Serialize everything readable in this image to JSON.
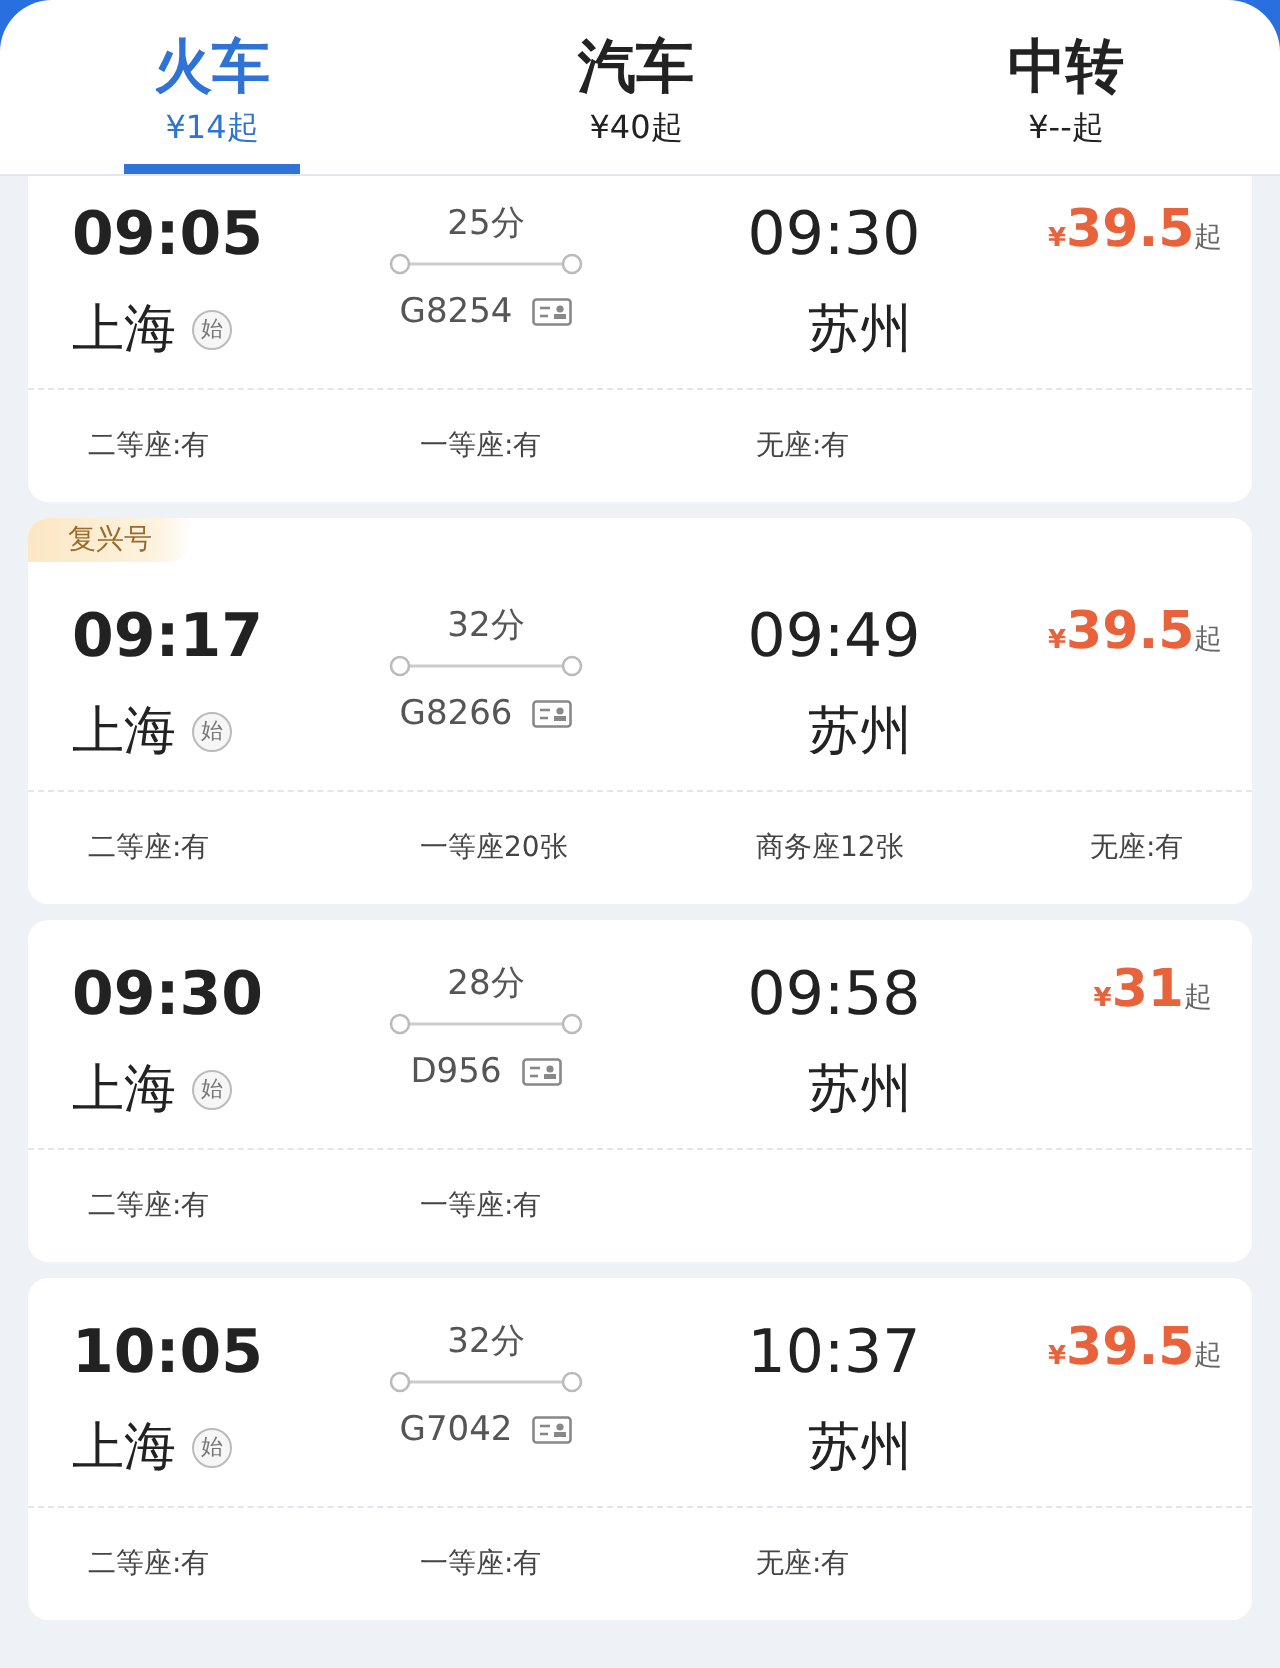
{
  "tabs": [
    {
      "label": "火车",
      "price": "¥14起",
      "selected": true
    },
    {
      "label": "汽车",
      "price": "¥40起",
      "selected": false
    },
    {
      "label": "中转",
      "price": "¥--起",
      "selected": false
    }
  ],
  "trains": [
    {
      "depart_time": "09:05",
      "depart_station": "上海",
      "origin_mark": "始",
      "duration": "25分",
      "train_no": "G8254",
      "arrive_time": "09:30",
      "arrive_station": "苏州",
      "currency": "¥",
      "price": "39.5",
      "price_suffix": "起",
      "seats": [
        "二等座:有",
        "一等座:有",
        "无座:有"
      ]
    },
    {
      "badge": "复兴号",
      "depart_time": "09:17",
      "depart_station": "上海",
      "origin_mark": "始",
      "duration": "32分",
      "train_no": "G8266",
      "arrive_time": "09:49",
      "arrive_station": "苏州",
      "currency": "¥",
      "price": "39.5",
      "price_suffix": "起",
      "seats": [
        "二等座:有",
        "一等座20张",
        "商务座12张",
        "无座:有"
      ]
    },
    {
      "depart_time": "09:30",
      "depart_station": "上海",
      "origin_mark": "始",
      "duration": "28分",
      "train_no": "D956",
      "arrive_time": "09:58",
      "arrive_station": "苏州",
      "currency": "¥",
      "price": "31",
      "price_suffix": "起",
      "seats": [
        "二等座:有",
        "一等座:有"
      ]
    },
    {
      "depart_time": "10:05",
      "depart_station": "上海",
      "origin_mark": "始",
      "duration": "32分",
      "train_no": "G7042",
      "arrive_time": "10:37",
      "arrive_station": "苏州",
      "currency": "¥",
      "price": "39.5",
      "price_suffix": "起",
      "seats": [
        "二等座:有",
        "一等座:有",
        "无座:有"
      ]
    }
  ]
}
